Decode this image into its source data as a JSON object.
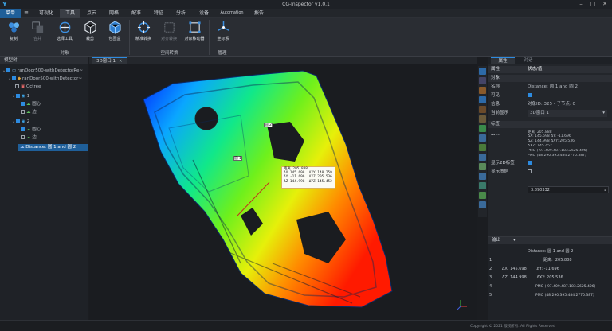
{
  "window": {
    "title": "CG-Inspector v1.0.1",
    "logo": "Y"
  },
  "menu": [
    "菜单",
    "可视化",
    "工具",
    "点云",
    "网格",
    "配准",
    "特征",
    "分析",
    "设备",
    "Automation",
    "报告"
  ],
  "ribbon": {
    "buttons": [
      {
        "label": "复制",
        "icon": "copy-icon"
      },
      {
        "label": "合并",
        "icon": "merge-icon"
      },
      {
        "label": "选择工具",
        "icon": "select-tool-icon"
      },
      {
        "label": "裁剪",
        "icon": "crop-icon"
      },
      {
        "label": "包围盒",
        "icon": "bounding-box-icon"
      },
      {
        "label": "精准转换",
        "icon": "precise-transform-icon"
      },
      {
        "label": "对齐转换",
        "icon": "align-transform-icon"
      },
      {
        "label": "对象移动器",
        "icon": "object-mover-icon"
      },
      {
        "label": "坐标系",
        "icon": "coordinate-system-icon"
      }
    ],
    "groups": [
      "对象",
      "空间转换",
      "管理"
    ]
  },
  "left": {
    "title": "模型树",
    "items": [
      "ranDoor500-withDetectorRe~",
      "ranDoor500-withDetector~",
      "Octree",
      "1",
      "圆心",
      "边",
      "2",
      "圆心",
      "边",
      "Distance: 圆 1 and 圆 2"
    ]
  },
  "viewport": {
    "tab": "3D窗口 1",
    "tag1": "圆 2",
    "tag2": "圆 1",
    "measure": [
      "距离 205.888",
      "ΔX 145.698  ΔXY 140.259",
      "ΔY -11.696  ΔXZ 205.536",
      "ΔZ 144.998  ΔYZ 145.452"
    ]
  },
  "right": {
    "tabs": [
      "属性",
      "对话"
    ],
    "header": [
      "属性",
      "状态/值"
    ],
    "rows": [
      {
        "k": "对象",
        "v": "",
        "sec": true
      },
      {
        "k": "名称",
        "v": "Distance: 圆 1 and 圆 2"
      },
      {
        "k": "可见",
        "v": "",
        "check": true
      },
      {
        "k": "信息",
        "v": "对象ID: 325 - 子节点: 0"
      },
      {
        "k": "当前显示",
        "v": "3D窗口 1"
      },
      {
        "k": "标签",
        "v": "",
        "sec": true
      },
      {
        "k": "内容",
        "v": "距离:  205.888"
      },
      {
        "k": "",
        "v": "ΔX: 145.698        ΔY: -11.696"
      },
      {
        "k": "",
        "v": "ΔZ: 144.998        ΔXY: 205.536"
      },
      {
        "k": "",
        "v": "ΔXZ: 145.452"
      },
      {
        "k": "",
        "v": "PMO (-97.409.487.183.2625.406)"
      },
      {
        "k": "",
        "v": "PMO (48.290.395.484.2770.387)"
      },
      {
        "k": "显示2D标签",
        "v": "",
        "check": true
      },
      {
        "k": "显示图例",
        "v": "",
        "check": false
      }
    ],
    "number": "3.890332"
  },
  "output": {
    "title": "输出",
    "lines": [
      "Distance: 圆 1 and 圆 2",
      "距离:  205.888",
      "ΔX: 145.698        ΔY: -11.696",
      "ΔZ: 144.998        ΔXY: 205.536",
      "PMO (-97.409.487.183.2625.406)",
      "PMO (48.290.395.484.2770.387)"
    ],
    "nums": [
      "1",
      "2",
      "3",
      "4",
      "5"
    ]
  },
  "status": {
    "copyright": "Copyright © 2021 版权所有. All Rights Reserved"
  },
  "colors": {
    "accent": "#2d8be0",
    "bg": "#1b1d21",
    "panel": "#23262b"
  }
}
